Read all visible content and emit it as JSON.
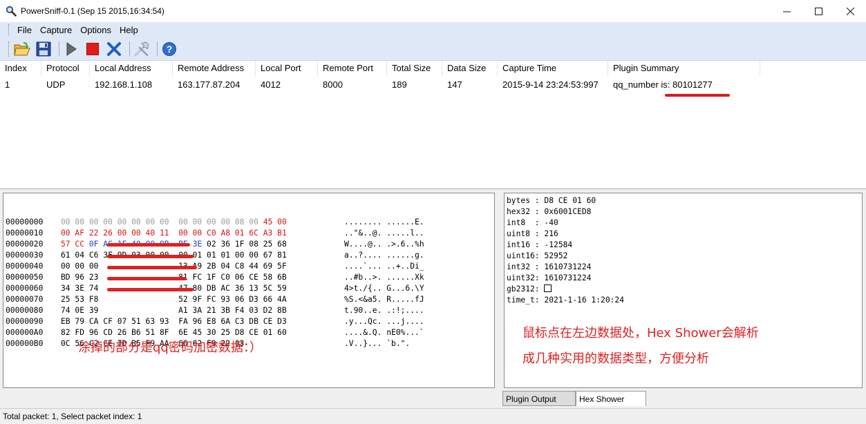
{
  "window": {
    "title": "PowerSniff-0.1 (Sep 15 2015,16:34:54)"
  },
  "menu": [
    "File",
    "Capture",
    "Options",
    "Help"
  ],
  "toolbar": {
    "icons": [
      "open-folder-icon",
      "save-icon",
      "play-icon",
      "stop-icon",
      "close-x-icon",
      "tools-icon",
      "help-icon"
    ]
  },
  "packet_list": {
    "columns": [
      "Index",
      "Protocol",
      "Local Address",
      "Remote Address",
      "Local Port",
      "Remote Port",
      "Total Size",
      "Data Size",
      "Capture Time",
      "Plugin Summary"
    ],
    "rows": [
      [
        "1",
        "UDP",
        "192.168.1.108",
        "163.177.87.204",
        "4012",
        "8000",
        "189",
        "147",
        "2015-9-14 23:24:53:997",
        "qq_number is: 80101277"
      ]
    ]
  },
  "hex_view": {
    "lines": [
      {
        "off": "00000000",
        "b1": "00 00 00 00 00 00 00 00",
        "b2": "00 00 00 00 08 00 45 00",
        "ascii": "........ ......E."
      },
      {
        "off": "00000010",
        "b1": "00 AF 22 26 00 00 40 11",
        "b2": "00 00 C0 A8 01 6C A3 B1",
        "ascii": "..\"&..@. .....l.."
      },
      {
        "off": "00000020",
        "b1": "57 CC 0F AC 1F 40 00 9B",
        "b2": "BE 3E 02 36 1F 08 25 68",
        "ascii": "W....@.. .>.6..%h"
      },
      {
        "off": "00000030",
        "b1": "61 04 C6 3F 9D 03 00 00",
        "b2": "00 01 01 01 00 00 67 81",
        "ascii": "a..?.... ......g."
      },
      {
        "off": "00000040",
        "b1": "00 00 00 ",
        "b2": "13 A9 2B 04 C8 44 69 5F",
        "ascii": "....`... ..+..Di_"
      },
      {
        "off": "00000050",
        "b1": "BD 96 23 ",
        "b2": "81 FC 1F C0 06 CE 58 6B",
        "ascii": "..#b..>. ......Xk"
      },
      {
        "off": "00000060",
        "b1": "34 3E 74 ",
        "b2": "47 80 DB AC 36 13 5C 59",
        "ascii": "4>t./{.. G...6.\\Y"
      },
      {
        "off": "00000070",
        "b1": "25 53 F8 ",
        "b2": "52 9F FC 93 06 D3 66 4A",
        "ascii": "%S.<&a5. R.....fJ"
      },
      {
        "off": "00000080",
        "b1": "74 0E 39 ",
        "b2": "A1 3A 21 3B F4 03 D2 8B",
        "ascii": "t.90..e. .:!;...."
      },
      {
        "off": "00000090",
        "b1": "EB 79 CA CF 07 51 63 93",
        "b2": "FA 96 E8 6A C3 DB CE D3",
        "ascii": ".y...Qc. ...j...."
      },
      {
        "off": "000000A0",
        "b1": "82 FD 96 CD 26 B6 51 8F",
        "b2": "6E 45 30 25 D8 CE 01 60",
        "ascii": "....&.Q. nE0%...`"
      },
      {
        "off": "000000B0",
        "b1": "0C 56 C2 CE 7D B5 F9 AA",
        "b2": "60 62 F9 22 03",
        "ascii": ".V..}... `b.\"."
      }
    ],
    "annotation": "涂掉的部分是qq密码加密数据：）"
  },
  "hex_shower": {
    "lines": [
      "bytes : D8 CE 01 60",
      "hex32 : 0x6001CED8",
      "int8  : -40",
      "uint8 : 216",
      "int16 : -12584",
      "uint16: 52952",
      "int32 : 1610731224",
      "uint32: 1610731224",
      "gb2312: ",
      "time_t: 2021-1-16 1:20:24"
    ],
    "annotation_line1": "鼠标点在左边数据处，Hex Shower会解析",
    "annotation_line2": "成几种实用的数据类型，方便分析"
  },
  "tabs": [
    "Plugin Output",
    "Hex Shower"
  ],
  "status": "Total packet: 1, Select packet index: 1"
}
